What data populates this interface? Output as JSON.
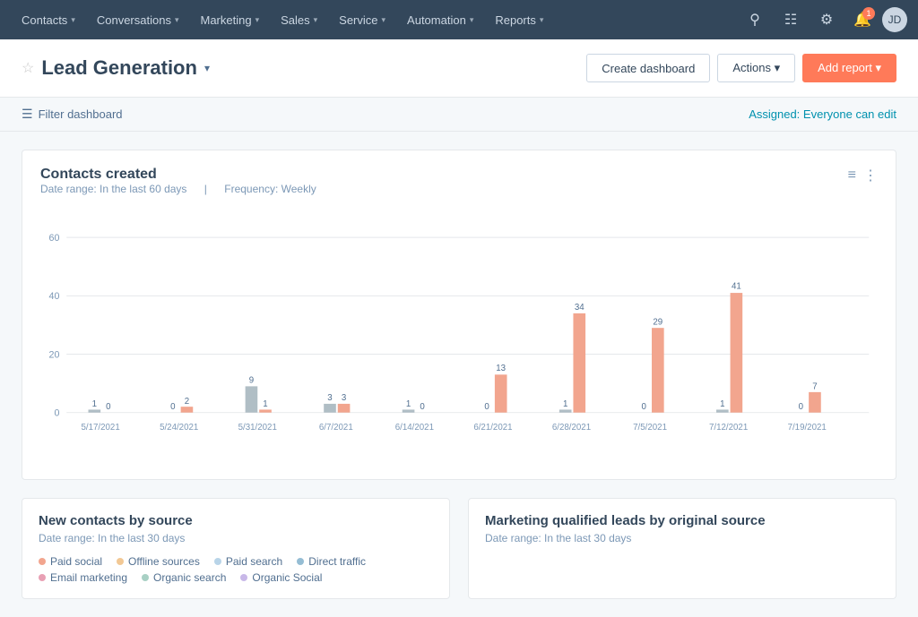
{
  "navbar": {
    "items": [
      {
        "label": "Contacts",
        "id": "contacts"
      },
      {
        "label": "Conversations",
        "id": "conversations"
      },
      {
        "label": "Marketing",
        "id": "marketing"
      },
      {
        "label": "Sales",
        "id": "sales"
      },
      {
        "label": "Service",
        "id": "service"
      },
      {
        "label": "Automation",
        "id": "automation"
      },
      {
        "label": "Reports",
        "id": "reports"
      }
    ],
    "notification_count": "1"
  },
  "page": {
    "title": "Lead Generation",
    "create_dashboard_label": "Create dashboard",
    "actions_label": "Actions",
    "add_report_label": "Add report"
  },
  "filter_bar": {
    "filter_label": "Filter dashboard",
    "assigned_label": "Assigned:",
    "assigned_value": "Everyone can edit"
  },
  "chart": {
    "title": "Contacts created",
    "date_range_label": "Date range: In the last 60 days",
    "frequency_label": "Frequency: Weekly",
    "y_labels": [
      "60",
      "40",
      "20",
      "0"
    ],
    "x_labels": [
      "5/17/2021",
      "5/24/2021",
      "5/31/2021",
      "6/7/2021",
      "6/14/2021",
      "6/21/2021",
      "6/28/2021",
      "7/5/2021",
      "7/12/2021",
      "7/19/2021"
    ],
    "bars": [
      {
        "x_label": "5/17/2021",
        "values": [
          1,
          0
        ]
      },
      {
        "x_label": "5/24/2021",
        "values": [
          0,
          2
        ]
      },
      {
        "x_label": "5/31/2021",
        "values": [
          9,
          1
        ]
      },
      {
        "x_label": "6/7/2021",
        "values": [
          3,
          3
        ]
      },
      {
        "x_label": "6/14/2021",
        "values": [
          1,
          0
        ]
      },
      {
        "x_label": "6/21/2021",
        "values": [
          0,
          13
        ]
      },
      {
        "x_label": "6/28/2021",
        "values": [
          1,
          34
        ]
      },
      {
        "x_label": "7/5/2021",
        "values": [
          0,
          29
        ]
      },
      {
        "x_label": "7/12/2021",
        "values": [
          1,
          41
        ]
      },
      {
        "x_label": "7/19/2021",
        "values": [
          0,
          7
        ]
      }
    ]
  },
  "panel_left": {
    "title": "New contacts by source",
    "date_range": "Date range: In the last 30 days",
    "legend": [
      {
        "label": "Paid social",
        "color": "#f2a58e"
      },
      {
        "label": "Offline sources",
        "color": "#f2c894"
      },
      {
        "label": "Paid search",
        "color": "#b8d4e8"
      },
      {
        "label": "Direct traffic",
        "color": "#95bdd4"
      },
      {
        "label": "Email marketing",
        "color": "#e8a0b4"
      },
      {
        "label": "Organic search",
        "color": "#a8d0c4"
      },
      {
        "label": "Organic Social",
        "color": "#c8b8e8"
      }
    ]
  },
  "panel_right": {
    "title": "Marketing qualified leads by original source",
    "date_range": "Date range: In the last 30 days"
  }
}
